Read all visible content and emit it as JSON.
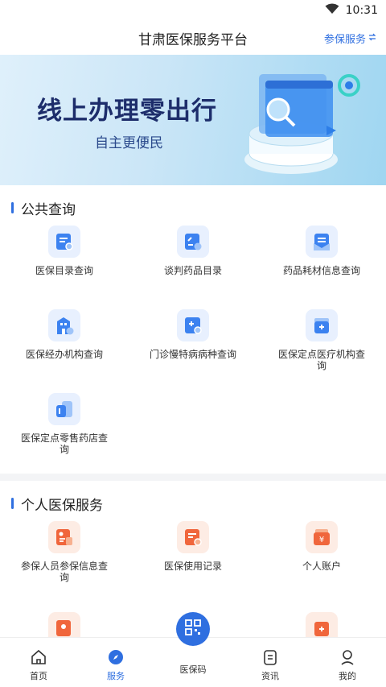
{
  "status_bar": {
    "time": "10:31"
  },
  "header": {
    "title": "甘肃医保服务平台",
    "enroll_service": "参保服务"
  },
  "banner": {
    "headline": "线上办理零出行",
    "subtitle": "自主更便民"
  },
  "public_query": {
    "title": "公共查询",
    "items": [
      {
        "label": "医保目录查询",
        "icon": "catalog-search-icon"
      },
      {
        "label": "谈判药品目录",
        "icon": "drug-catalog-icon"
      },
      {
        "label": "药品耗材信息查询",
        "icon": "medical-supplies-icon"
      },
      {
        "label": "医保经办机构查询",
        "icon": "agency-building-icon"
      },
      {
        "label": "门诊慢特病病种查询",
        "icon": "chronic-disease-icon"
      },
      {
        "label": "医保定点医疗机构查询",
        "icon": "medical-institution-icon"
      },
      {
        "label": "医保定点零售药店查询",
        "icon": "pharmacy-icon"
      }
    ]
  },
  "personal_service": {
    "title": "个人医保服务",
    "items": [
      {
        "label": "参保人员参保信息查询",
        "icon": "insured-info-icon"
      },
      {
        "label": "医保使用记录",
        "icon": "usage-record-icon"
      },
      {
        "label": "个人账户",
        "icon": "personal-account-icon"
      }
    ]
  },
  "tabbar": {
    "items": [
      {
        "label": "首页",
        "icon": "home-icon"
      },
      {
        "label": "服务",
        "icon": "service-compass-icon"
      },
      {
        "label": "医保码",
        "icon": "qr-code-icon"
      },
      {
        "label": "资讯",
        "icon": "news-icon"
      },
      {
        "label": "我的",
        "icon": "profile-icon"
      }
    ]
  },
  "colors": {
    "accent": "#2f6fe0",
    "orange": "#f0663c"
  }
}
